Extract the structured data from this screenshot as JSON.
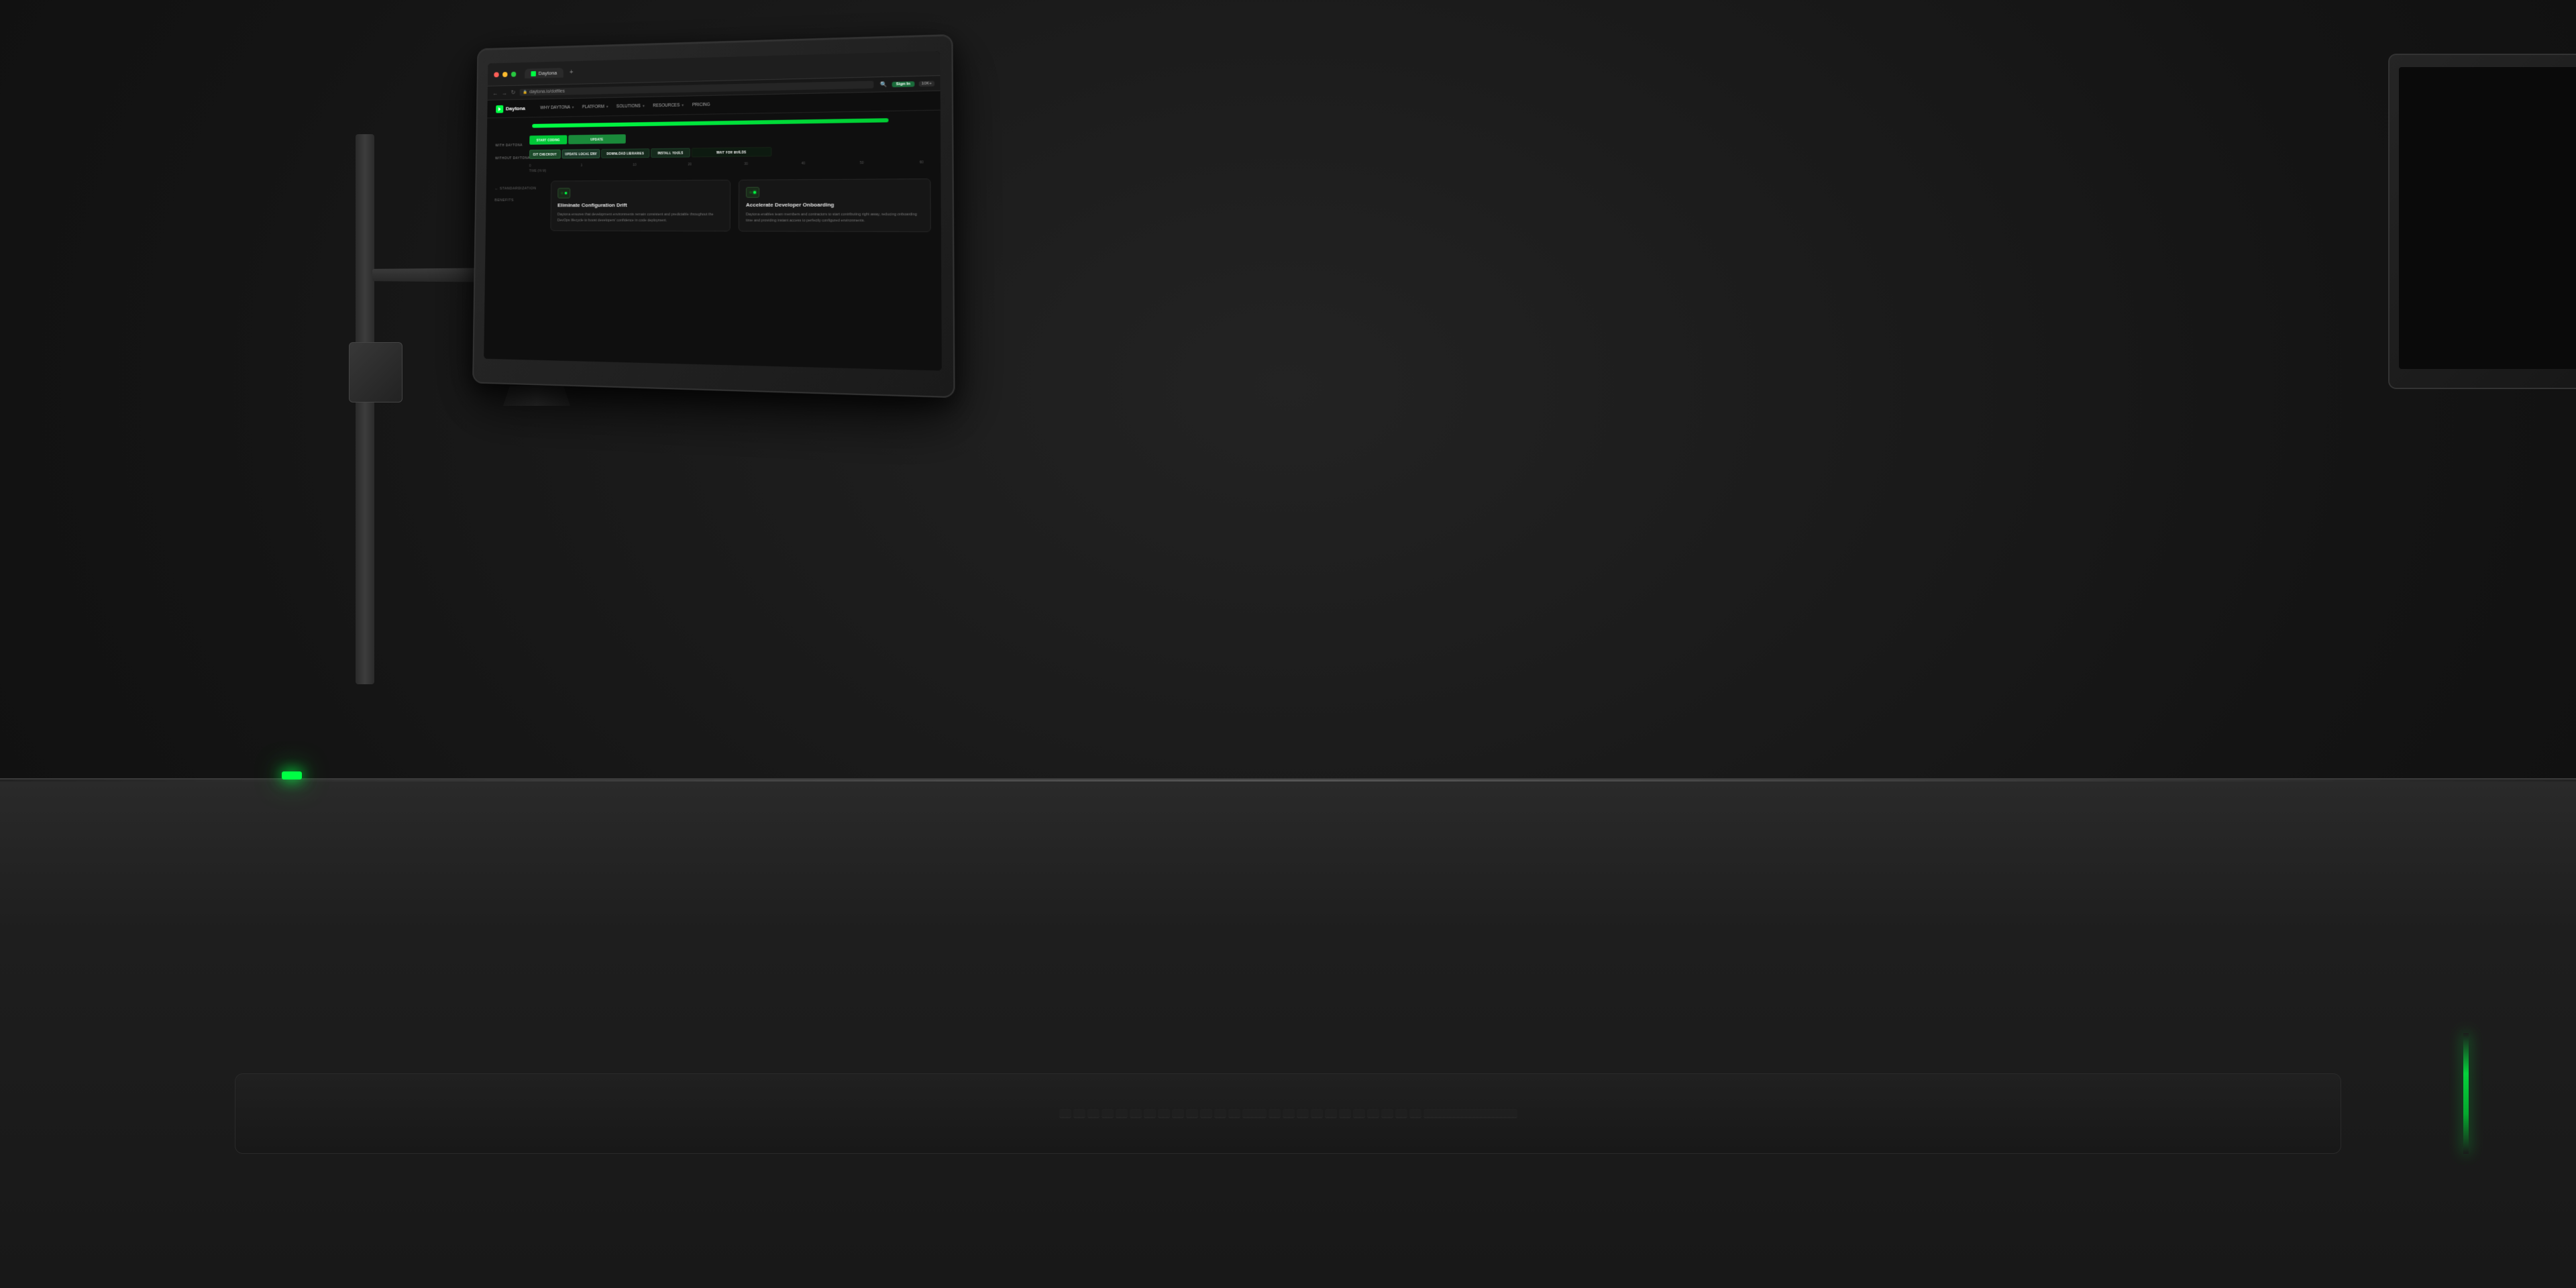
{
  "background": {
    "color": "#1a1a1a"
  },
  "browser": {
    "tab_name": "Daytona",
    "url": "daytona.io/dotfiles",
    "signin_label": "Sign In",
    "stars_label": "10K+",
    "new_tab_icon": "+"
  },
  "site": {
    "logo": "Daytona",
    "nav": {
      "items": [
        {
          "label": "WHY DAYTONA",
          "has_dropdown": true
        },
        {
          "label": "PLATFORM",
          "has_dropdown": true
        },
        {
          "label": "SOLUTIONS",
          "has_dropdown": true
        },
        {
          "label": "RESOURCES",
          "has_dropdown": true
        },
        {
          "label": "PRICING",
          "has_dropdown": false
        }
      ]
    }
  },
  "chart": {
    "with_daytona_label": "WITH DAYTONA",
    "without_daytona_label": "WITHOUT DAYTONA",
    "time_label": "TIME (IN M)",
    "axis_values": [
      "0",
      "1",
      "10",
      "20",
      "30",
      "40",
      "50",
      "60"
    ],
    "with_daytona_bars": [
      {
        "label": "START CODING",
        "color": "#00c837"
      },
      {
        "label": "UPDATE",
        "color": "#1a8a3a"
      }
    ],
    "without_daytona_bars": [
      {
        "label": "GIT CHECKOUT",
        "color": "#1c4a2a"
      },
      {
        "label": "UPDATE LOCAL ENV",
        "color": "#1c3a2a"
      },
      {
        "label": "DOWNLOAD LIBRARIES",
        "color": "#152a1c"
      },
      {
        "label": "INSTALL TOOLS",
        "color": "#152a1c"
      },
      {
        "label": "WAIT FOR BUILDS",
        "color": "#0d1a10"
      }
    ]
  },
  "features": {
    "sidebar_label": "← STANDARDIZATION BENEFITS",
    "cards": [
      {
        "id": "config-drift",
        "title": "Eliminate Configuration Drift",
        "description": "Daytona ensures that development environments remain consistent and predictable throughout the DevOps lifecycle to boost developers' confidence in code deployment."
      },
      {
        "id": "onboarding",
        "title": "Accelerate Developer Onboarding",
        "description": "Daytona enables team members and contractors to start contributing right away, reducing onboarding time and providing instant access to perfectly configured environments."
      }
    ]
  }
}
